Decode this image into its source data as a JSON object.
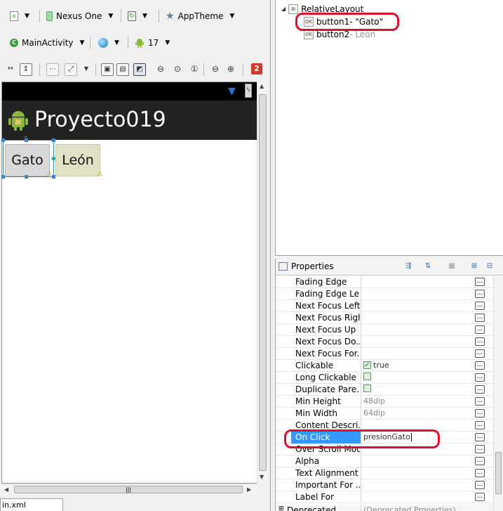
{
  "toolbar": {
    "device": "Nexus One",
    "theme": "AppTheme",
    "activity": "MainActivity",
    "api_level": "17",
    "error_count": "2"
  },
  "canvas": {
    "app_title": "Proyecto019",
    "buttons": [
      {
        "label": "Gato"
      },
      {
        "label": "León"
      }
    ]
  },
  "file_tab": "in.xml",
  "outline": {
    "root": "RelativeLayout",
    "items": [
      {
        "name": "button1",
        "text": " - \"Gato\""
      },
      {
        "name": "button2",
        "text": " - León"
      }
    ]
  },
  "properties": {
    "title": "Properties",
    "rows": [
      {
        "name": "Fading Edge",
        "value": ""
      },
      {
        "name": "Fading Edge Le...",
        "value": ""
      },
      {
        "name": "Next Focus Left",
        "value": ""
      },
      {
        "name": "Next Focus Right",
        "value": ""
      },
      {
        "name": "Next Focus Up",
        "value": ""
      },
      {
        "name": "Next Focus Do...",
        "value": ""
      },
      {
        "name": "Next Focus For...",
        "value": ""
      },
      {
        "name": "Clickable",
        "value": "true",
        "checkbox": "checked"
      },
      {
        "name": "Long Clickable",
        "value": "",
        "checkbox": "empty"
      },
      {
        "name": "Duplicate Pare...",
        "value": "",
        "checkbox": "empty"
      },
      {
        "name": "Min Height",
        "value": "48dip",
        "gray": true
      },
      {
        "name": "Min Width",
        "value": "64dip",
        "gray": true
      },
      {
        "name": "Content Descri...",
        "value": ""
      },
      {
        "name": "On Click",
        "value": "presionGato",
        "selected": true
      },
      {
        "name": "Over Scroll Mode",
        "value": ""
      },
      {
        "name": "Alpha",
        "value": ""
      },
      {
        "name": "Text Alignment",
        "value": ""
      },
      {
        "name": "Important For ...",
        "value": ""
      },
      {
        "name": "Label For",
        "value": ""
      }
    ],
    "footer_name": "Deprecated",
    "footer_value": "(Deprecated Properties)"
  },
  "colors": {
    "highlight": "#e0102a",
    "selection": "#3399ff",
    "action_bar": "#222222"
  }
}
